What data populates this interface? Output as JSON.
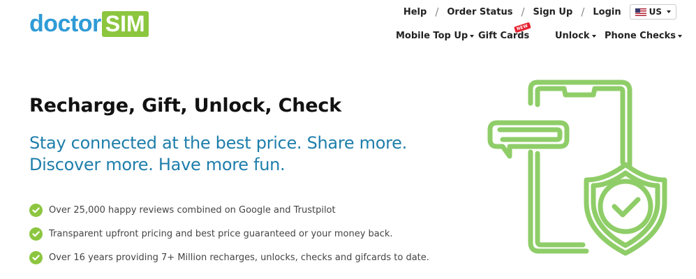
{
  "brand": {
    "logo_part1": "doctor",
    "logo_part2": "SIM"
  },
  "topnav": {
    "help": "Help",
    "order_status": "Order Status",
    "sign_up": "Sign Up",
    "login": "Login",
    "separator": "/",
    "country": "US"
  },
  "mainnav": {
    "mobile_top_up": "Mobile Top Up",
    "gift_cards": "Gift Cards",
    "new_badge": "NEW",
    "unlock": "Unlock",
    "phone_checks": "Phone Checks"
  },
  "hero": {
    "title": "Recharge, Gift, Unlock, Check",
    "subtitle_line1": "Stay connected at the best price. Share more.",
    "subtitle_line2": "Discover more. Have more fun."
  },
  "features": [
    "Over 25,000 happy reviews combined on Google and Trustpilot",
    "Transparent upfront pricing and best price guaranteed or your money back.",
    "Over 16 years providing 7+ Million recharges, unlocks, checks and gifcards to date."
  ],
  "colors": {
    "brand_blue": "#2f9bd6",
    "brand_green": "#8cc63f",
    "subtitle_blue": "#1e7eab",
    "badge_red": "#e5202e"
  },
  "icons": {
    "check": "check-circle-icon",
    "illustration": "phone-shield-chat-icon",
    "flag": "us-flag-icon",
    "dropdown": "caret-down-icon"
  }
}
